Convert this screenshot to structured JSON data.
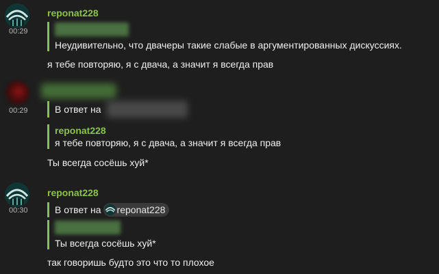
{
  "messages": [
    {
      "author": "reponat228",
      "time": "00:29",
      "quote_text": "Неудивительно, что двачеры такие слабые в аргументированных дискуссиях.",
      "text": "я тебе повторяю, я с двача, а значит я всегда прав"
    },
    {
      "time": "00:29",
      "reply_label": "В ответ на",
      "quote_author": "reponat228",
      "quote_text": "я тебе повторяю, я с двача, а значит я всегда прав",
      "text": "Ты всегда сосёшь хуй*"
    },
    {
      "author": "reponat228",
      "time": "00:30",
      "reply_label": "В ответ на",
      "mention": "reponat228",
      "quote_text": "Ты всегда сосёшь хуй*",
      "text": "так говоришь будто это что то плохое"
    }
  ],
  "colors": {
    "background": "#1e1e1e",
    "accent": "#8bc34a",
    "text": "#f0f0f0",
    "time": "#b5b5b5"
  }
}
